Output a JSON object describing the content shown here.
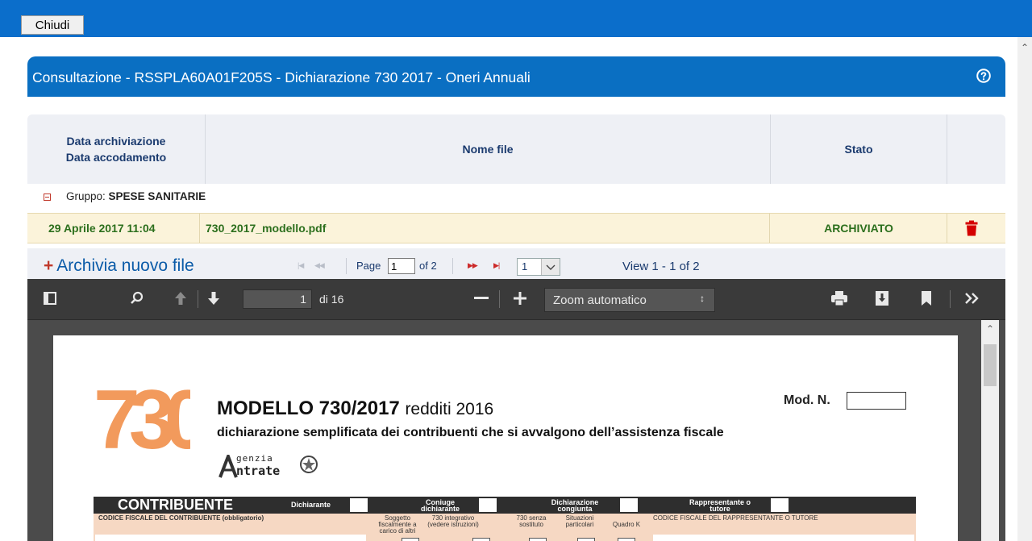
{
  "topbar": {
    "close_label": "Chiudi"
  },
  "panel": {
    "title": "Consultazione - RSSPLA60A01F205S - Dichiarazione 730 2017 - Oneri Annuali"
  },
  "table": {
    "headers": {
      "date_line1": "Data archiviazione",
      "date_line2": "Data accodamento",
      "file": "Nome file",
      "status": "Stato"
    },
    "group": {
      "prefix": "Gruppo:",
      "name": "SPESE SANITARIE"
    },
    "rows": [
      {
        "date": "29 Aprile 2017 11:04",
        "file": "730_2017_modello.pdf",
        "status": "ARCHIVIATO"
      }
    ]
  },
  "pager": {
    "add_label": "Archivia nuovo file",
    "page_label": "Page",
    "current_page": "1",
    "of_label": "of 2",
    "rows_per_page": "1",
    "view_text": "View 1 - 1 of 2"
  },
  "viewer": {
    "page_number": "1",
    "of_pages": "di 16",
    "zoom": "Zoom automatico",
    "icons": [
      "sidebar-toggle-icon",
      "search-icon",
      "previous-page-icon",
      "next-page-icon",
      "zoom-out-icon",
      "zoom-in-icon",
      "print-icon",
      "download-icon",
      "bookmark-icon",
      "tools-icon"
    ]
  },
  "document": {
    "logo_text": "730",
    "title": "MODELLO 730/2017",
    "title_sub": "redditi 2016",
    "subtitle": "dichiarazione semplificata dei contribuenti che si avvalgono dell’assistenza fiscale",
    "agency_line1": "genzia",
    "agency_line2": "ntrate",
    "mod_label": "Mod. N.",
    "section": "CONTRIBUENTE",
    "roles": [
      "Dichiarante",
      "Coniuge dichiarante",
      "Dichiarazione congiunta",
      "Rappresentante o tutore"
    ],
    "fields": {
      "cf": "CODICE FISCALE DEL CONTRIBUENTE (obbligatorio)",
      "soggetto": "Soggetto fiscalmente a carico di altri",
      "integrativo": "730 integrativo (vedere istruzioni)",
      "senza": "730 senza sostituto",
      "situazioni": "Situazioni particolari",
      "quadro_k": "Quadro K",
      "rep_cf": "CODICE FISCALE DEL RAPPRESENTANTE O TUTORE"
    }
  },
  "colors": {
    "brand_blue": "#0a6fc2",
    "row_highlight": "#fbf3da",
    "status_green": "#2c6f1d",
    "danger": "#d40000",
    "logo_orange": "#f29a5c"
  }
}
